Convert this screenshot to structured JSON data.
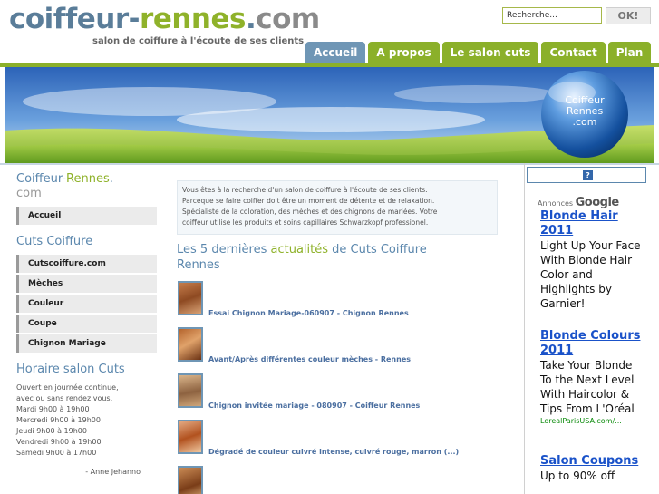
{
  "header": {
    "logo_part1": "coiffeur-",
    "logo_part2": "rennes",
    "logo_part3": ".",
    "logo_part4": "com",
    "tagline": "salon de coiffure à l'écoute de ses clients"
  },
  "search": {
    "value": "Recherche...",
    "button_label": "OK!"
  },
  "nav": {
    "tabs": [
      {
        "label": "Accueil",
        "active": true
      },
      {
        "label": "A propos"
      },
      {
        "label": "Le salon cuts"
      },
      {
        "label": "Contact"
      },
      {
        "label": "Plan"
      }
    ]
  },
  "banner": {
    "badge_line1": "Coiffeur",
    "badge_line2": "Rennes",
    "badge_line3": ".com"
  },
  "sidebar": {
    "site_title_part1": "Coiffeur-",
    "site_title_part2": "Rennes",
    "site_title_part3": ".",
    "site_title_part4": "com",
    "home_item": "Accueil",
    "cuts_heading": "Cuts Coiffure",
    "cuts_items": [
      {
        "label": "Cutscoiffure.com"
      },
      {
        "label": "Mèches"
      },
      {
        "label": "Couleur"
      },
      {
        "label": "Coupe"
      },
      {
        "label": "Chignon Mariage"
      }
    ],
    "hours_heading": "Horaire salon Cuts",
    "hours_lines": [
      "Ouvert en journée continue,",
      "avec ou sans rendez vous.",
      "Mardi 9h00 à 19h00",
      "Mercredi 9h00 à 19h00",
      "Jeudi 9h00 à 19h00",
      "Vendredi 9h00 à 19h00",
      "Samedi 9h00 à 17h00"
    ],
    "author": "- Anne Jehanno"
  },
  "main": {
    "intro_lines": [
      "Vous êtes à la recherche d'un salon de coiffure à l'écoute de ses clients.",
      "Parceque se faire coiffer doit être un moment de détente et de relaxation.",
      "Spécialiste de la coloration, des mèches et des chignons de mariées. Votre",
      "coiffeur utilise les produits et soins capillaires Schwarzkopf professionel."
    ],
    "news_title_part1": "Les 5 dernières ",
    "news_title_part2": "actualités",
    "news_title_part3": " de Cuts Coiffure",
    "news_title_part4": "Rennes",
    "news": [
      {
        "title": "Essai Chignon Mariage-060907 - Chignon Rennes"
      },
      {
        "title": "Avant/Après différentes couleur mèches - Rennes"
      },
      {
        "title": "Chignon invitée mariage - 080907 - Coiffeur Rennes"
      },
      {
        "title": "Dégradé de couleur cuivré intense, cuivré rouge, marron (...)"
      },
      {
        "title": ""
      }
    ]
  },
  "ads": {
    "help_icon": "?",
    "label_prefix": "Annonces ",
    "label_brand": "Google",
    "items": [
      {
        "title": "Blonde Hair 2011",
        "body": "Light Up Your Face With Blonde Hair Color and Highlights by Garnier!",
        "url": ""
      },
      {
        "title": "Blonde Colours 2011",
        "body": "Take Your Blonde To the Next Level With Haircolor & Tips From L'Oréal",
        "url": "LorealParisUSA.com/..."
      },
      {
        "title": "Salon Coupons",
        "body": "Up to 90% off",
        "url": ""
      }
    ]
  },
  "colors": {
    "accent_green": "#8bb02a",
    "accent_blue": "#6f96b5",
    "link_blue": "#4b6fa0",
    "ad_link": "#1a52c9"
  }
}
